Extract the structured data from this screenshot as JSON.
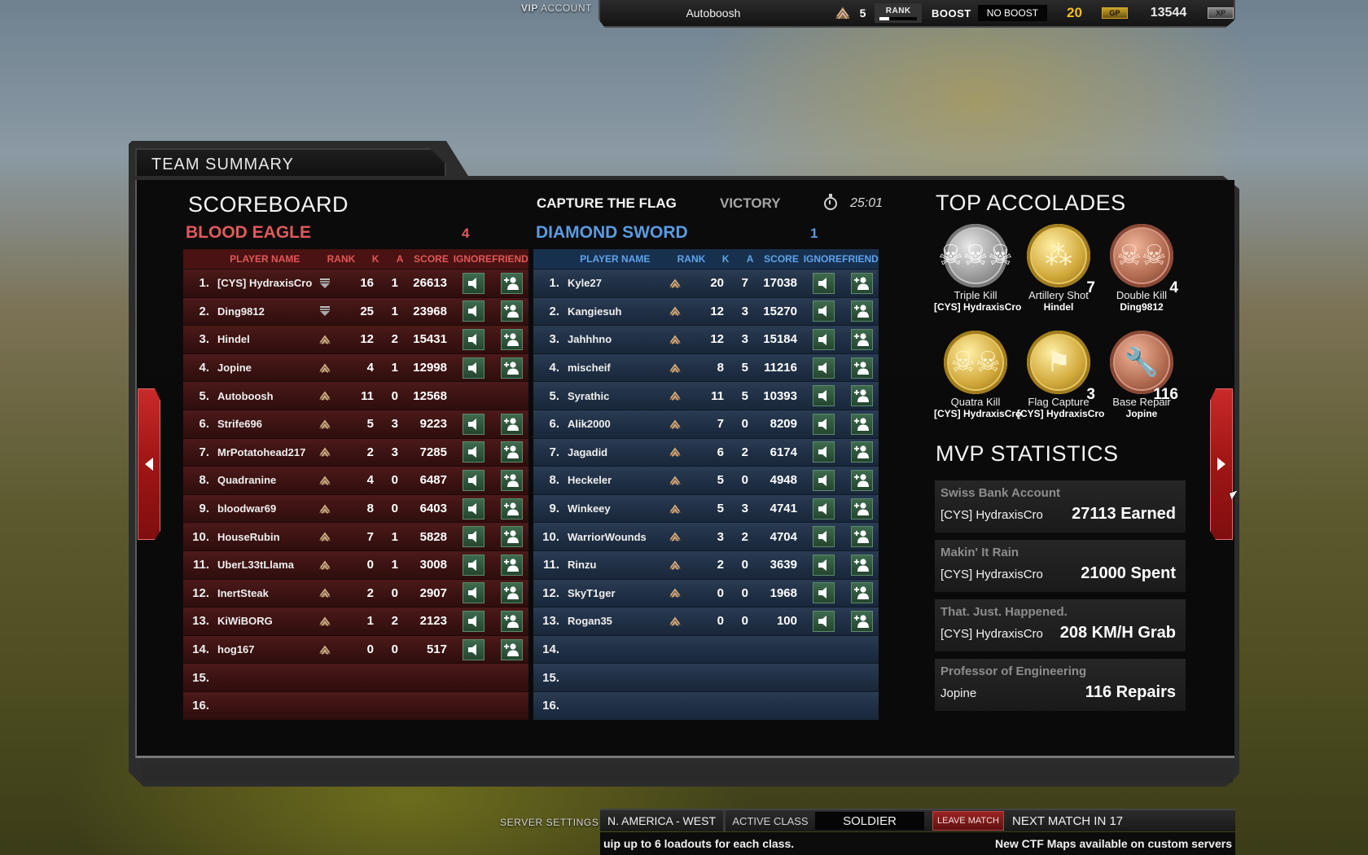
{
  "top_bar": {
    "account_type_bold": "VIP",
    "account_type": "ACCOUNT",
    "username": "Autoboosh",
    "rank_level": "5",
    "rank_label": "RANK",
    "rank_progress_percent": 25,
    "boost_label": "BOOST",
    "boost_value": "NO BOOST",
    "gold_amount": "20",
    "gp_badge": "GP",
    "xp_amount": "13544",
    "xp_badge": "XP"
  },
  "panel": {
    "title": "TEAM SUMMARY"
  },
  "scoreboard": {
    "title": "SCOREBOARD",
    "mode": "CAPTURE THE FLAG",
    "result": "VICTORY",
    "timer_icon": "stopwatch-icon",
    "match_time": "25:01",
    "columns": {
      "player_name": "PLAYER NAME",
      "rank": "RANK",
      "kills": "K",
      "assists": "A",
      "score": "SCORE",
      "ignore": "IGNORE",
      "friend": "FRIEND"
    },
    "teams": [
      {
        "name": "BLOOD EAGLE",
        "score": "4",
        "color": "#e05a5a",
        "rows": [
          {
            "num": "1.",
            "name": "[CYS] HydraxisCro",
            "rank_icon": "rank-shield-icon",
            "k": "16",
            "a": "1",
            "score": "26613",
            "actions": true
          },
          {
            "num": "2.",
            "name": "Ding9812",
            "rank_icon": "rank-shield-icon",
            "k": "25",
            "a": "1",
            "score": "23968",
            "actions": true
          },
          {
            "num": "3.",
            "name": "Hindel",
            "rank_icon": "rank-chevron-icon",
            "k": "12",
            "a": "2",
            "score": "15431",
            "actions": true
          },
          {
            "num": "4.",
            "name": "Jopine",
            "rank_icon": "rank-chevron-icon",
            "k": "4",
            "a": "1",
            "score": "12998",
            "actions": true
          },
          {
            "num": "5.",
            "name": "Autoboosh",
            "rank_icon": "rank-chevron-icon",
            "k": "11",
            "a": "0",
            "score": "12568",
            "actions": false
          },
          {
            "num": "6.",
            "name": "Strife696",
            "rank_icon": "rank-chevron-icon",
            "k": "5",
            "a": "3",
            "score": "9223",
            "actions": true
          },
          {
            "num": "7.",
            "name": "MrPotatohead217",
            "rank_icon": "rank-chevron-icon",
            "k": "2",
            "a": "3",
            "score": "7285",
            "actions": true
          },
          {
            "num": "8.",
            "name": "Quadranine",
            "rank_icon": "rank-chevron-icon",
            "k": "4",
            "a": "0",
            "score": "6487",
            "actions": true
          },
          {
            "num": "9.",
            "name": "bloodwar69",
            "rank_icon": "rank-chevron-icon",
            "k": "8",
            "a": "0",
            "score": "6403",
            "actions": true
          },
          {
            "num": "10.",
            "name": "HouseRubin",
            "rank_icon": "rank-chevron-icon",
            "k": "7",
            "a": "1",
            "score": "5828",
            "actions": true
          },
          {
            "num": "11.",
            "name": "UberL33tLlama",
            "rank_icon": "rank-chevron-icon",
            "k": "0",
            "a": "1",
            "score": "3008",
            "actions": true
          },
          {
            "num": "12.",
            "name": "InertSteak",
            "rank_icon": "rank-chevron-icon",
            "k": "2",
            "a": "0",
            "score": "2907",
            "actions": true
          },
          {
            "num": "13.",
            "name": "KiWiBORG",
            "rank_icon": "rank-chevron-icon",
            "k": "1",
            "a": "2",
            "score": "2123",
            "actions": true
          },
          {
            "num": "14.",
            "name": "hog167",
            "rank_icon": "rank-chevron-icon",
            "k": "0",
            "a": "0",
            "score": "517",
            "actions": true
          },
          {
            "num": "15.",
            "name": "",
            "rank_icon": "",
            "k": "",
            "a": "",
            "score": "",
            "actions": false
          },
          {
            "num": "16.",
            "name": "",
            "rank_icon": "",
            "k": "",
            "a": "",
            "score": "",
            "actions": false
          }
        ]
      },
      {
        "name": "DIAMOND SWORD",
        "score": "1",
        "color": "#5a9be0",
        "rows": [
          {
            "num": "1.",
            "name": "Kyle27",
            "rank_icon": "rank-chevron-icon",
            "k": "20",
            "a": "7",
            "score": "17038",
            "actions": true
          },
          {
            "num": "2.",
            "name": "Kangiesuh",
            "rank_icon": "rank-chevron-icon",
            "k": "12",
            "a": "3",
            "score": "15270",
            "actions": true
          },
          {
            "num": "3.",
            "name": "Jahhhno",
            "rank_icon": "rank-chevron-icon",
            "k": "12",
            "a": "3",
            "score": "15184",
            "actions": true
          },
          {
            "num": "4.",
            "name": "mischeif",
            "rank_icon": "rank-chevron-icon",
            "k": "8",
            "a": "5",
            "score": "11216",
            "actions": true
          },
          {
            "num": "5.",
            "name": "Syrathic",
            "rank_icon": "rank-chevron-icon",
            "k": "11",
            "a": "5",
            "score": "10393",
            "actions": true
          },
          {
            "num": "6.",
            "name": "Alik2000",
            "rank_icon": "rank-chevron-icon",
            "k": "7",
            "a": "0",
            "score": "8209",
            "actions": true
          },
          {
            "num": "7.",
            "name": "Jagadid",
            "rank_icon": "rank-chevron-icon",
            "k": "6",
            "a": "2",
            "score": "6174",
            "actions": true
          },
          {
            "num": "8.",
            "name": "Heckeler",
            "rank_icon": "rank-chevron-icon",
            "k": "5",
            "a": "0",
            "score": "4948",
            "actions": true
          },
          {
            "num": "9.",
            "name": "Winkeey",
            "rank_icon": "rank-chevron-icon",
            "k": "5",
            "a": "3",
            "score": "4741",
            "actions": true
          },
          {
            "num": "10.",
            "name": "WarriorWounds",
            "rank_icon": "rank-chevron-icon",
            "k": "3",
            "a": "2",
            "score": "4704",
            "actions": true
          },
          {
            "num": "11.",
            "name": "Rinzu",
            "rank_icon": "rank-chevron-icon",
            "k": "2",
            "a": "0",
            "score": "3639",
            "actions": true
          },
          {
            "num": "12.",
            "name": "SkyT1ger",
            "rank_icon": "rank-chevron-icon",
            "k": "0",
            "a": "0",
            "score": "1968",
            "actions": true
          },
          {
            "num": "13.",
            "name": "Rogan35",
            "rank_icon": "rank-chevron-icon",
            "k": "0",
            "a": "0",
            "score": "100",
            "actions": true
          },
          {
            "num": "14.",
            "name": "",
            "rank_icon": "",
            "k": "",
            "a": "",
            "score": "",
            "actions": false
          },
          {
            "num": "15.",
            "name": "",
            "rank_icon": "",
            "k": "",
            "a": "",
            "score": "",
            "actions": false
          },
          {
            "num": "16.",
            "name": "",
            "rank_icon": "",
            "k": "",
            "a": "",
            "score": "",
            "actions": false
          }
        ]
      }
    ]
  },
  "accolades": {
    "title": "TOP ACCOLADES",
    "items": [
      {
        "title": "Triple Kill",
        "player": "[CYS] HydraxisCro",
        "count": "",
        "tier": "silver",
        "icon": "triple-skull-medal-icon",
        "glyph": "☠☠☠"
      },
      {
        "title": "Artillery Shot",
        "player": "Hindel",
        "count": "7",
        "tier": "gold",
        "icon": "artillery-shells-medal-icon",
        "glyph": "⁂"
      },
      {
        "title": "Double Kill",
        "player": "Ding9812",
        "count": "4",
        "tier": "bronze",
        "icon": "double-skull-medal-icon",
        "glyph": "☠☠"
      },
      {
        "title": "Quatra Kill",
        "player": "[CYS] HydraxisCro",
        "count": "",
        "tier": "gold",
        "icon": "quad-skull-medal-icon",
        "glyph": "☠☠"
      },
      {
        "title": "Flag Capture",
        "player": "[CYS] HydraxisCro",
        "count": "3",
        "tier": "gold",
        "icon": "flag-medal-icon",
        "glyph": "⚑"
      },
      {
        "title": "Base Repair",
        "player": "Jopine",
        "count": "116",
        "tier": "bronze",
        "icon": "wrench-medal-icon",
        "glyph": "🔧"
      }
    ]
  },
  "mvp": {
    "title": "MVP STATISTICS",
    "items": [
      {
        "title": "Swiss Bank Account",
        "player": "[CYS] HydraxisCro",
        "value": "27113 Earned"
      },
      {
        "title": "Makin' It Rain",
        "player": "[CYS] HydraxisCro",
        "value": "21000 Spent"
      },
      {
        "title": "That. Just. Happened.",
        "player": "[CYS] HydraxisCro",
        "value": "208 KM/H Grab"
      },
      {
        "title": "Professor of Engineering",
        "player": "Jopine",
        "value": "116 Repairs"
      }
    ]
  },
  "bottom_bar": {
    "server_settings": "SERVER SETTINGS",
    "region": "N. AMERICA - WEST",
    "active_class_label": "ACTIVE CLASS",
    "active_class": "SOLDIER",
    "leave_match": "LEAVE MATCH",
    "next_match": "NEXT MATCH IN 17",
    "ticker_left": "uip up to 6 loadouts for each class.",
    "ticker_right": "New CTF Maps available on custom servers"
  }
}
